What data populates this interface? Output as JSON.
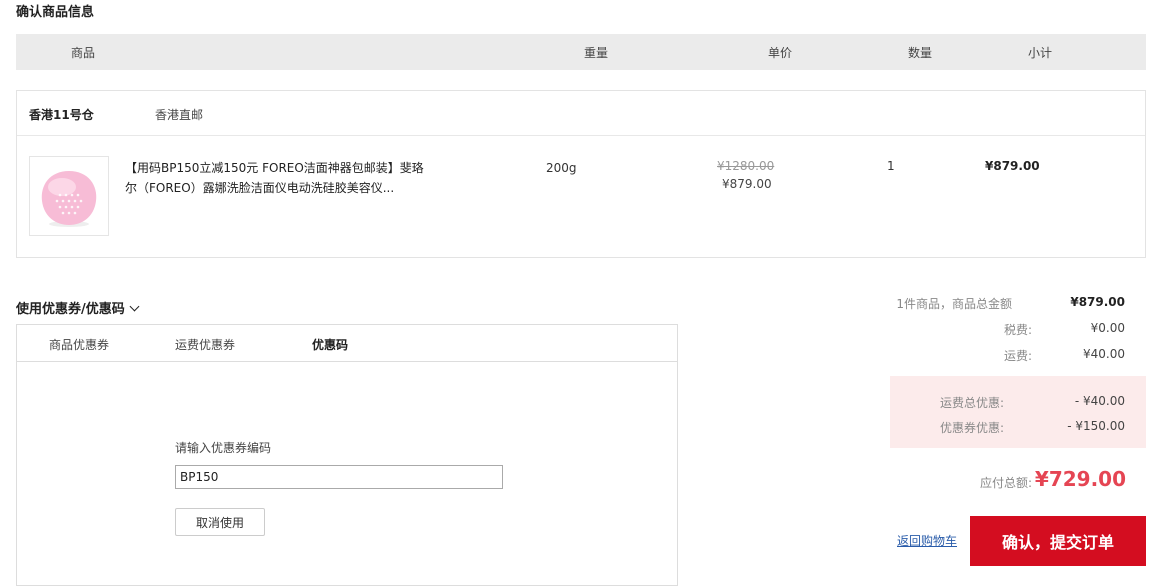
{
  "page": {
    "section_title": "确认商品信息"
  },
  "table_header": {
    "product": "商品",
    "weight": "重量",
    "unit_price": "单价",
    "quantity": "数量",
    "subtotal": "小计"
  },
  "warehouse": {
    "name": "香港11号仓",
    "shipping_method": "香港直邮"
  },
  "product": {
    "title": "【用码BP150立减150元 FOREO洁面神器包邮装】斐珞尔（FOREO）露娜洗脸洁面仪电动洗硅胶美容仪...",
    "weight": "200g",
    "original_price": "¥1280.00",
    "unit_price": "¥879.00",
    "quantity": "1",
    "subtotal": "¥879.00",
    "image_colors": {
      "body": "#f7bcd6",
      "highlight": "#fde3ee"
    }
  },
  "coupon": {
    "toggle_label": "使用优惠券/优惠码",
    "tabs": [
      "商品优惠券",
      "运费优惠券",
      "优惠码"
    ],
    "active_tab": "优惠码",
    "code_label": "请输入优惠券编码",
    "code_value": "BP150",
    "cancel_label": "取消使用"
  },
  "summary": {
    "items_total_label": "1件商品，商品总金额",
    "items_total_value": "¥879.00",
    "tax_label": "税费:",
    "tax_value": "¥0.00",
    "shipping_label": "运费:",
    "shipping_value": "¥40.00",
    "shipping_discount_label": "运费总优惠:",
    "shipping_discount_value": "- ¥40.00",
    "coupon_discount_label": "优惠券优惠:",
    "coupon_discount_value": "- ¥150.00",
    "total_label": "应付总额:",
    "total_value": "¥729.00",
    "back_to_cart": "返回购物车",
    "submit_label": "确认，提交订单"
  },
  "colors": {
    "accent": "#d40d20",
    "total_price": "#e54553",
    "discount_bg": "#fcebeb",
    "link": "#2a5caa"
  }
}
